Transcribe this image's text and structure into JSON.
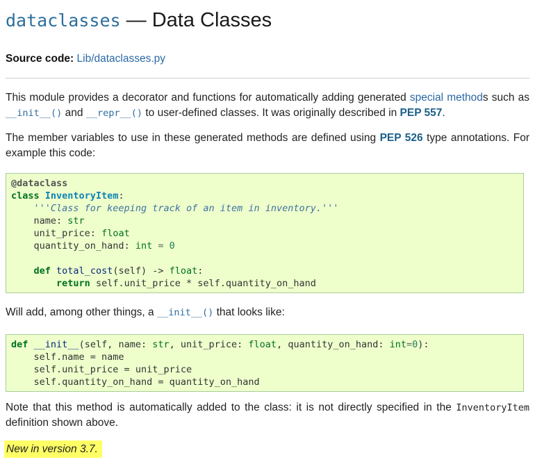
{
  "title": {
    "module": "dataclasses",
    "dash": "—",
    "rest": "Data Classes"
  },
  "source": {
    "label": "Source code:",
    "link": "Lib/dataclasses.py"
  },
  "intro": {
    "p1_a": "This module provides a decorator and functions for automatically adding generated ",
    "p1_link": "special method",
    "p1_b": "s such as ",
    "p1_code1": "__init__()",
    "p1_c": " and ",
    "p1_code2": "__repr__()",
    "p1_d": " to user-defined classes. It was originally described in ",
    "p1_pep": "PEP 557",
    "p1_e": ".",
    "p2_a": "The member variables to use in these generated methods are defined using ",
    "p2_pep": "PEP 526",
    "p2_b": " type annotations. For example this code:"
  },
  "code1": {
    "l1": "@dataclass",
    "l2_kw": "class",
    "l2_name": "InventoryItem",
    "l2_end": ":",
    "l3": "'''Class for keeping track of an item in inventory.'''",
    "l4_name": "name",
    "l4_type": "str",
    "l5_name": "unit_price",
    "l5_type": "float",
    "l6_name": "quantity_on_hand",
    "l6_type": "int",
    "l6_val": "0",
    "l8_kw": "def",
    "l8_fn": "total_cost",
    "l8_sig": "(self) -> ",
    "l8_type": "float",
    "l9_kw": "return",
    "l9_expr": "self.unit_price * self.quantity_on_hand"
  },
  "mid": {
    "a": "Will add, among other things, a ",
    "code": "__init__()",
    "b": " that looks like:"
  },
  "code2": {
    "l1_kw": "def",
    "l1_fn": "__init__",
    "l1_a": "(self, name: ",
    "l1_t1": "str",
    "l1_b": ", unit_price: ",
    "l1_t2": "float",
    "l1_c": ", quantity_on_hand: ",
    "l1_t3": "int",
    "l1_d": "=",
    "l1_n": "0",
    "l1_e": "):",
    "l2": "self.name = name",
    "l3": "self.unit_price = unit_price",
    "l4": "self.quantity_on_hand = quantity_on_hand"
  },
  "note": {
    "a": "Note that this method is automatically added to the class: it is not directly specified in the ",
    "code": "InventoryItem",
    "b": " definition shown above."
  },
  "version": "New in version 3.7."
}
